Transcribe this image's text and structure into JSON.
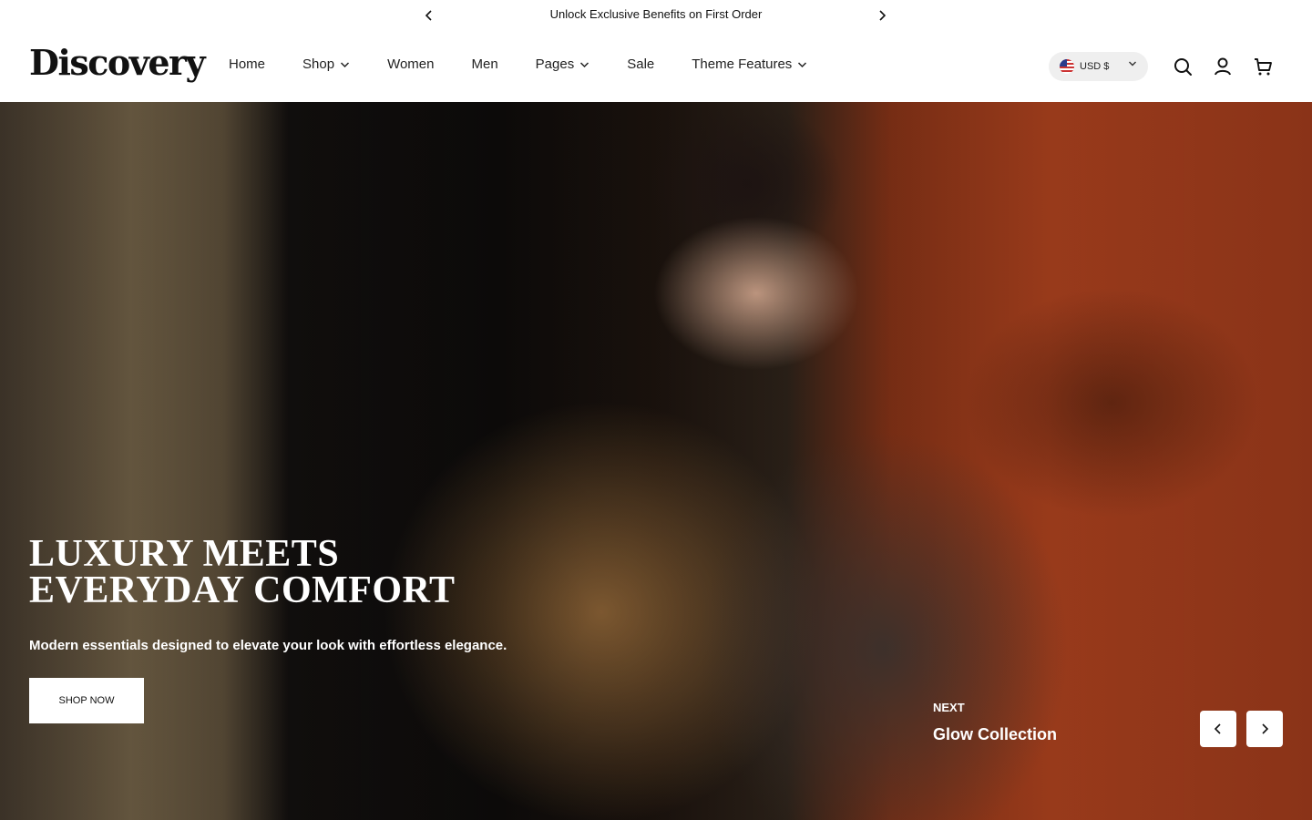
{
  "announcement": {
    "message": "Unlock Exclusive Benefits on First Order",
    "prev_icon": "chevron-left-icon",
    "next_icon": "chevron-right-icon"
  },
  "header": {
    "logo": "Discovery",
    "nav": [
      {
        "label": "Home",
        "has_dropdown": false
      },
      {
        "label": "Shop",
        "has_dropdown": true
      },
      {
        "label": "Women",
        "has_dropdown": false
      },
      {
        "label": "Men",
        "has_dropdown": false
      },
      {
        "label": "Pages",
        "has_dropdown": true
      },
      {
        "label": "Sale",
        "has_dropdown": false
      },
      {
        "label": "Theme Features",
        "has_dropdown": true
      }
    ],
    "currency": {
      "label": "USD $",
      "flag": "us-flag-icon"
    },
    "icons": [
      "search-icon",
      "account-icon",
      "cart-icon"
    ]
  },
  "hero": {
    "title_line1": "LUXURY MEETS",
    "title_line2": "EVERYDAY COMFORT",
    "subtitle": "Modern essentials designed to elevate your look with effortless elegance.",
    "cta": "SHOP NOW",
    "next_label": "NEXT",
    "next_title": "Glow Collection"
  },
  "colors": {
    "text": "#111111",
    "currency_bg": "#efefef",
    "hero_accent": "#9b3b1b",
    "button_bg": "#ffffff"
  }
}
